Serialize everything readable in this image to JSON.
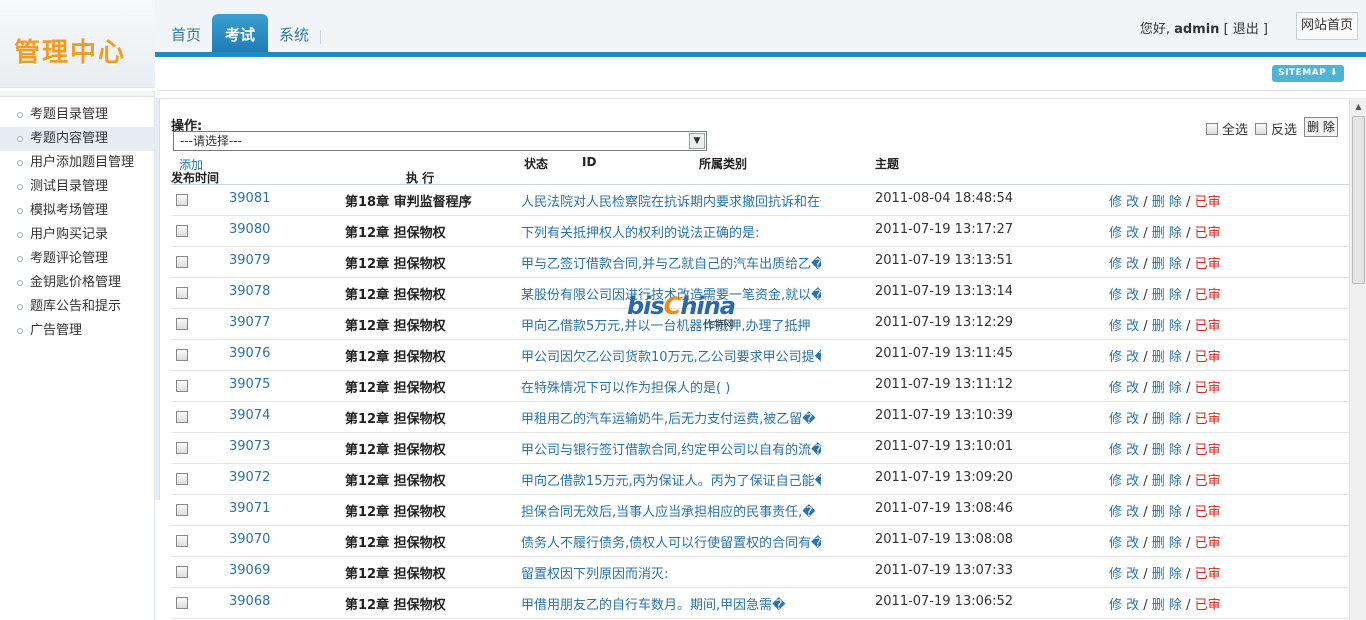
{
  "app": {
    "logo_text": "管理中心"
  },
  "nav": {
    "tabs": [
      {
        "label": "首页",
        "active": false
      },
      {
        "label": "考试",
        "active": true
      },
      {
        "label": "系统",
        "active": false
      }
    ]
  },
  "user": {
    "greeting": "您好,",
    "name": "admin",
    "logout_label": "[ 退出 ]",
    "site_home_label": "网站首页"
  },
  "sitemap_label": "SITEMAP ⬇",
  "sidebar": {
    "items": [
      {
        "label": "考题目录管理",
        "active": false
      },
      {
        "label": "考题内容管理",
        "active": true
      },
      {
        "label": "用户添加题目管理",
        "active": false
      },
      {
        "label": "测试目录管理",
        "active": false
      },
      {
        "label": "模拟考场管理",
        "active": false
      },
      {
        "label": "用户购买记录",
        "active": false
      },
      {
        "label": "考题评论管理",
        "active": false
      },
      {
        "label": "金钥匙价格管理",
        "active": false
      },
      {
        "label": "题库公告和提示",
        "active": false
      },
      {
        "label": "广告管理",
        "active": false
      }
    ]
  },
  "toolbar": {
    "ops_label": "操作:",
    "select_value": "---请选择---",
    "select_all_label": "全选",
    "invert_label": "反选",
    "delete_label": "删 除",
    "add_label": "添加",
    "exec_label": "执 行"
  },
  "table": {
    "headers": {
      "status": "状态",
      "id": "ID",
      "category": "所属类别",
      "title": "主题",
      "time": "发布时间"
    },
    "rows": [
      {
        "id": "39081",
        "category": "第18章 审判监督程序",
        "title": "人民法院对人民检察院在抗诉期内要求撤回抗诉和在�",
        "time": "2011-08-04 18:48:54"
      },
      {
        "id": "39080",
        "category": "第12章 担保物权",
        "title": "下列有关抵押权人的权利的说法正确的是:",
        "time": "2011-07-19 13:17:27"
      },
      {
        "id": "39079",
        "category": "第12章 担保物权",
        "title": "甲与乙签订借款合同,并与乙就自己的汽车出质给乙�",
        "time": "2011-07-19 13:13:51"
      },
      {
        "id": "39078",
        "category": "第12章 担保物权",
        "title": "某股份有限公司因进行技术改造需要一笔资金,就以�",
        "time": "2011-07-19 13:13:14"
      },
      {
        "id": "39077",
        "category": "第12章 担保物权",
        "title": "甲向乙借款5万元,并以一台机器作抵押,办理了抵押",
        "time": "2011-07-19 13:12:29"
      },
      {
        "id": "39076",
        "category": "第12章 担保物权",
        "title": "甲公司因欠乙公司货款10万元,乙公司要求甲公司提�",
        "time": "2011-07-19 13:11:45"
      },
      {
        "id": "39075",
        "category": "第12章 担保物权",
        "title": "在特殊情况下可以作为担保人的是( )",
        "time": "2011-07-19 13:11:12"
      },
      {
        "id": "39074",
        "category": "第12章 担保物权",
        "title": "甲租用乙的汽车运输奶牛,后无力支付运费,被乙留�",
        "time": "2011-07-19 13:10:39"
      },
      {
        "id": "39073",
        "category": "第12章 担保物权",
        "title": "甲公司与银行签订借款合同,约定甲公司以自有的流�",
        "time": "2011-07-19 13:10:01"
      },
      {
        "id": "39072",
        "category": "第12章 担保物权",
        "title": "甲向乙借款15万元,丙为保证人。丙为了保证自己能�",
        "time": "2011-07-19 13:09:20"
      },
      {
        "id": "39071",
        "category": "第12章 担保物权",
        "title": "担保合同无效后,当事人应当承担相应的民事责任,�",
        "time": "2011-07-19 13:08:46"
      },
      {
        "id": "39070",
        "category": "第12章 担保物权",
        "title": "债务人不履行债务,债权人可以行使留置权的合同有�",
        "time": "2011-07-19 13:08:08"
      },
      {
        "id": "39069",
        "category": "第12章 担保物权",
        "title": "留置权因下列原因而消灭:",
        "time": "2011-07-19 13:07:33"
      },
      {
        "id": "39068",
        "category": "第12章 担保物权",
        "title": " 甲借用朋友乙的自行车数月。期间,甲因急需�",
        "time": "2011-07-19 13:06:52"
      }
    ],
    "row_actions": {
      "edit": "修 改",
      "sep": " / ",
      "delete": "删 除",
      "approved": "已审"
    }
  },
  "watermark": {
    "brand_main": "bis",
    "brand_o": "C",
    "brand_rest": "hina",
    "sub": "比特网"
  },
  "colors": {
    "accent": "#1e8bc3",
    "link": "#2b72a8",
    "approved": "#d9261c",
    "logo": "#f39b21"
  }
}
